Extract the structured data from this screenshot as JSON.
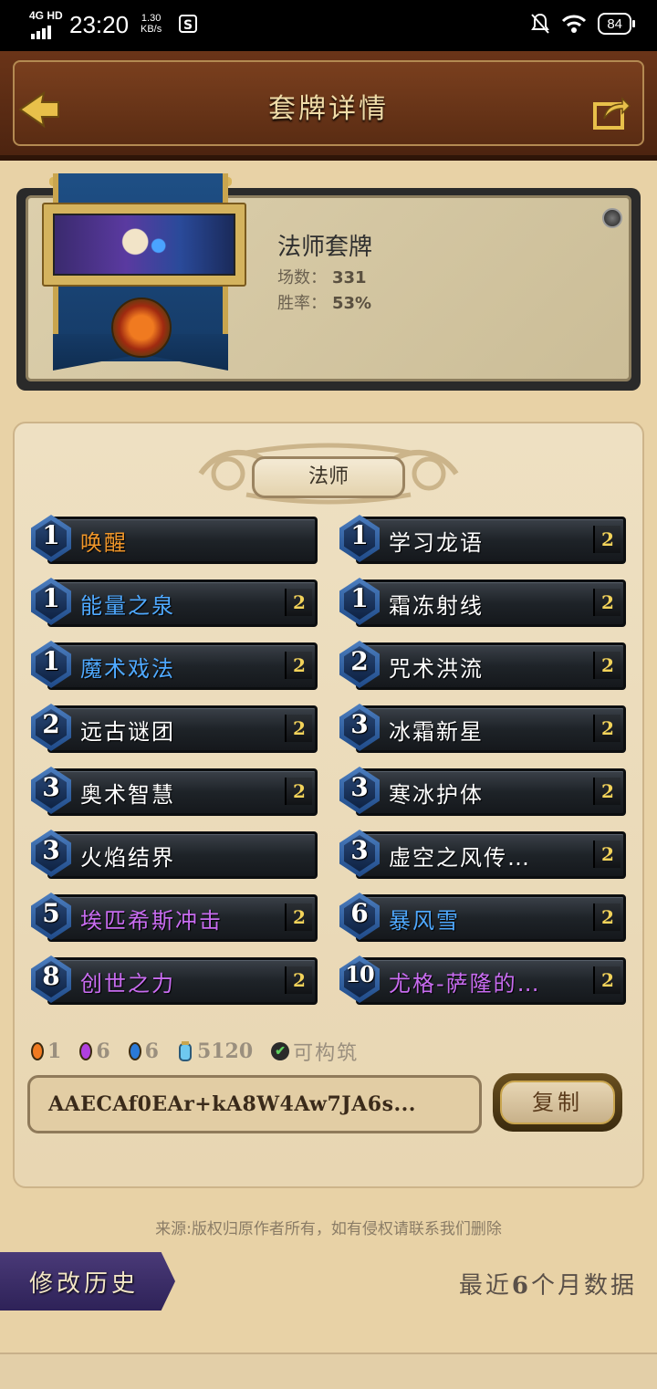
{
  "status_bar": {
    "network": "4G HD",
    "time": "23:20",
    "speed_value": "1.30",
    "speed_unit": "KB/s",
    "app_icon": "S",
    "battery": "84"
  },
  "header": {
    "title": "套牌详情"
  },
  "summary": {
    "deck_name": "法师套牌",
    "games_label": "场数：",
    "games_value": "331",
    "winrate_label": "胜率：",
    "winrate_value": "53%"
  },
  "deck": {
    "class_label": "法师",
    "cards_left": [
      {
        "cost": "1",
        "name": "唤醒",
        "count": "",
        "rarity": "legendary"
      },
      {
        "cost": "1",
        "name": "能量之泉",
        "count": "2",
        "rarity": "rare"
      },
      {
        "cost": "1",
        "name": "魔术戏法",
        "count": "2",
        "rarity": "rare"
      },
      {
        "cost": "2",
        "name": "远古谜团",
        "count": "2",
        "rarity": "common"
      },
      {
        "cost": "3",
        "name": "奥术智慧",
        "count": "2",
        "rarity": "common"
      },
      {
        "cost": "3",
        "name": "火焰结界",
        "count": "",
        "rarity": "common"
      },
      {
        "cost": "5",
        "name": "埃匹希斯冲击",
        "count": "2",
        "rarity": "epic"
      },
      {
        "cost": "8",
        "name": "创世之力",
        "count": "2",
        "rarity": "epic"
      }
    ],
    "cards_right": [
      {
        "cost": "1",
        "name": "学习龙语",
        "count": "2",
        "rarity": "common"
      },
      {
        "cost": "1",
        "name": "霜冻射线",
        "count": "2",
        "rarity": "common"
      },
      {
        "cost": "2",
        "name": "咒术洪流",
        "count": "2",
        "rarity": "common"
      },
      {
        "cost": "3",
        "name": "冰霜新星",
        "count": "2",
        "rarity": "common"
      },
      {
        "cost": "3",
        "name": "寒冰护体",
        "count": "2",
        "rarity": "common"
      },
      {
        "cost": "3",
        "name": "虚空之风传…",
        "count": "2",
        "rarity": "common"
      },
      {
        "cost": "6",
        "name": "暴风雪",
        "count": "2",
        "rarity": "rare"
      },
      {
        "cost": "10",
        "name": "尤格-萨隆的…",
        "count": "2",
        "rarity": "epic"
      }
    ],
    "rarity_colors": {
      "common": "#ffffff",
      "rare": "#4fa9ff",
      "epic": "#c86cf0",
      "legendary": "#f0962a"
    }
  },
  "dust": {
    "legendary_count": "1",
    "epic_count": "6",
    "rare_count": "6",
    "dust_cost": "5120",
    "craftable_label": "可构筑"
  },
  "deck_code": {
    "code": "AAECAf0EAr+kA8W4Aw7JA6s...",
    "copy_label": "复制"
  },
  "footer": {
    "source_note": "来源:版权归原作者所有，如有侵权请联系我们删除",
    "history_label": "修改历史",
    "recent_prefix": "最近",
    "recent_months": "6",
    "recent_suffix": "个月数据"
  }
}
